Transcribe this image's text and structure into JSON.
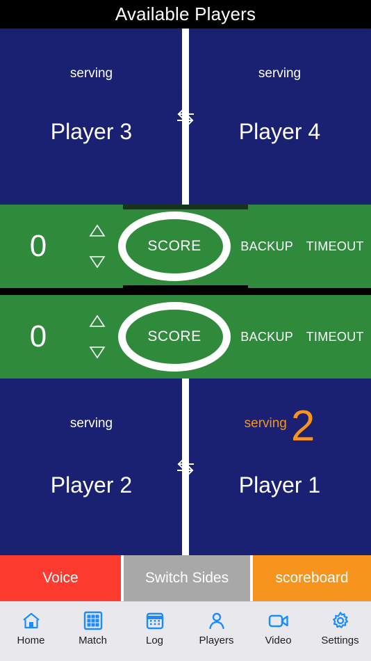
{
  "header": {
    "title": "Available Players"
  },
  "colors": {
    "navy": "#1b2172",
    "green": "#2f8a3b",
    "orange": "#f7941d",
    "red": "#fc3a2e",
    "gray": "#a8a8a8",
    "black": "#000000",
    "tab_blue": "#1a8cff"
  },
  "top_row": {
    "left": {
      "serving_label": "serving",
      "serving_active": false,
      "name": "Player 3"
    },
    "right": {
      "serving_label": "serving",
      "serving_active": false,
      "name": "Player 4"
    },
    "swap_icon": "swap-horizontal-arrows-icon"
  },
  "bottom_row": {
    "left": {
      "serving_label": "serving",
      "serving_active": false,
      "name": "Player 2"
    },
    "right": {
      "serving_label": "serving",
      "serving_active": true,
      "serve_count": "2",
      "name": "Player 1"
    },
    "swap_icon": "swap-horizontal-arrows-icon"
  },
  "score_panels": [
    {
      "score": "0",
      "increment_icon": "triangle-up-icon",
      "decrement_icon": "triangle-down-icon",
      "score_button": "SCORE",
      "backup_button": "BACKUP",
      "timeout_button": "TIMEOUT"
    },
    {
      "score": "0",
      "increment_icon": "triangle-up-icon",
      "decrement_icon": "triangle-down-icon",
      "score_button": "SCORE",
      "backup_button": "BACKUP",
      "timeout_button": "TIMEOUT"
    }
  ],
  "action_bar": {
    "voice": "Voice",
    "switch_sides": "Switch Sides",
    "scoreboard": "scoreboard"
  },
  "tabbar": {
    "items": [
      {
        "label": "Home",
        "icon": "home-icon"
      },
      {
        "label": "Match",
        "icon": "grid-icon"
      },
      {
        "label": "Log",
        "icon": "calendar-icon"
      },
      {
        "label": "Players",
        "icon": "person-icon"
      },
      {
        "label": "Video",
        "icon": "video-camera-icon"
      },
      {
        "label": "Settings",
        "icon": "gear-icon"
      }
    ]
  }
}
